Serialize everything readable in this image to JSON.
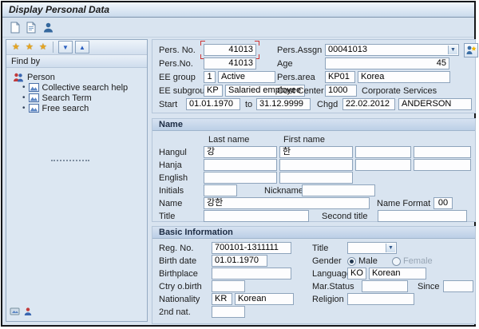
{
  "window": {
    "title": "Display Personal Data"
  },
  "icons": {
    "star": "★",
    "arrow_up": "▲",
    "arrow_down": "▼",
    "chevron_down": "▼",
    "bullet": "•"
  },
  "toolbar": {
    "icons": [
      "document-icon",
      "document-list-icon",
      "person-icon"
    ]
  },
  "sidebar": {
    "find_by_label": "Find by",
    "tree": {
      "root_label": "Person",
      "items": [
        {
          "label": "Collective search help"
        },
        {
          "label": "Search Term"
        },
        {
          "label": "Free search"
        }
      ]
    }
  },
  "header": {
    "pers_no_label": "Pers. No.",
    "pers_no_value": "41013",
    "pers_assgn_label": "Pers.Assgn",
    "pers_assgn_value": "00041013",
    "pers_no2_label": "Pers.No.",
    "pers_no2_value": "41013",
    "age_label": "Age",
    "age_value": "45",
    "ee_group_label": "EE group",
    "ee_group_value": "1",
    "ee_group_text": "Active",
    "pers_area_label": "Pers.area",
    "pers_area_value": "KP01",
    "pers_area_text": "Korea",
    "ee_subgroup_label": "EE subgroup",
    "ee_subgroup_value": "KP",
    "ee_subgroup_text": "Salaried employee",
    "cost_center_label": "Cost Center",
    "cost_center_value": "1000",
    "cost_center_text": "Corporate Services",
    "start_label": "Start",
    "start_value": "01.01.1970",
    "to_label": "to",
    "to_value": "31.12.9999",
    "chgd_label": "Chgd",
    "chgd_date": "22.02.2012",
    "chgd_by": "ANDERSON"
  },
  "name": {
    "section_title": "Name",
    "col_last_name": "Last name",
    "col_first_name": "First name",
    "hangul_label": "Hangul",
    "hangul_last": "강",
    "hangul_first": "한",
    "hanja_label": "Hanja",
    "english_label": "English",
    "initials_label": "Initials",
    "nickname_label": "Nickname",
    "name_label": "Name",
    "name_value": "강한",
    "name_format_label": "Name Format",
    "name_format_value": "00",
    "title_label": "Title",
    "second_title_label": "Second title"
  },
  "basic": {
    "section_title": "Basic Information",
    "reg_no_label": "Reg. No.",
    "reg_no_value": "700101-1311111",
    "title_label": "Title",
    "birth_date_label": "Birth date",
    "birth_date_value": "01.01.1970",
    "gender_label": "Gender",
    "gender_male": "Male",
    "gender_female": "Female",
    "birthplace_label": "Birthplace",
    "language_label": "Language",
    "language_value": "KO",
    "language_text": "Korean",
    "ctry_birth_label": "Ctry o.birth",
    "mar_status_label": "Mar.Status",
    "since_label": "Since",
    "nationality_label": "Nationality",
    "nationality_value": "KR",
    "nationality_text": "Korean",
    "religion_label": "Religion",
    "second_nat_label": "2nd nat."
  }
}
